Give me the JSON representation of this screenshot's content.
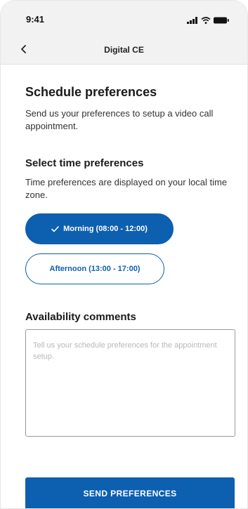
{
  "status_bar": {
    "time": "9:41"
  },
  "nav": {
    "back_icon": "chevron-left-icon",
    "title": "Digital CE"
  },
  "header": {
    "title": "Schedule preferences",
    "description": "Send us your preferences to setup a video call appointment."
  },
  "time_preferences": {
    "title": "Select time preferences",
    "description": "Time preferences are displayed on your local time zone.",
    "options": [
      {
        "label": "Morning (08:00 - 12:00)",
        "selected": true,
        "icon": "check-icon"
      },
      {
        "label": "Afternoon (13:00 - 17:00)",
        "selected": false
      }
    ]
  },
  "comments": {
    "title": "Availability comments",
    "placeholder": "Tell us your schedule preferences for the appointment setup.",
    "value": ""
  },
  "submit": {
    "label": "SEND PREFERENCES"
  },
  "colors": {
    "primary": "#0d5fb0",
    "header_background": "#f2f2f2"
  }
}
